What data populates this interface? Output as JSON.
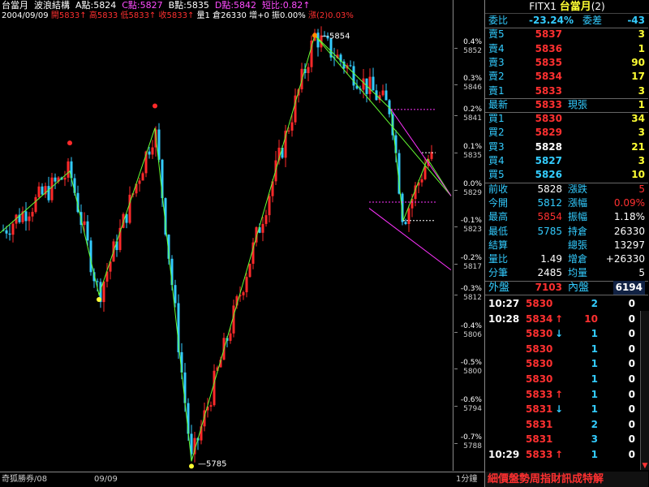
{
  "header": {
    "title": "台當月",
    "mode": "波浪結構",
    "a_point": "A點:5824",
    "c_point": "C點:5827",
    "b_point": "B點:5835",
    "d_point": "D點:5842",
    "short_ratio": "短比:0.82↑",
    "date": "2004/09/09",
    "open": "開5833↑",
    "high": "高5833",
    "low": "低5833↑",
    "close": "收5833↑",
    "volume": "量1",
    "open_interest": "倉26330",
    "increase": "增+0",
    "amplitude": "振0.00%",
    "rise": "漲(2)0.03%"
  },
  "footer": {
    "left": "奇狐勝券/08",
    "date": "09/09",
    "interval": "1分鐘"
  },
  "axis": {
    "ticks": [
      {
        "pct": "0.4%",
        "price": "5852",
        "value": 5852
      },
      {
        "pct": "0.3%",
        "price": "5846",
        "value": 5846
      },
      {
        "pct": "0.2%",
        "price": "5841",
        "value": 5841
      },
      {
        "pct": "0.1%",
        "price": "5835",
        "value": 5835
      },
      {
        "pct": "0.0%",
        "price": "5829",
        "value": 5829
      },
      {
        "pct": "-0.1%",
        "price": "5823",
        "value": 5823
      },
      {
        "pct": "-0.2%",
        "price": "5817",
        "value": 5817
      },
      {
        "pct": "-0.3%",
        "price": "5812",
        "value": 5812
      },
      {
        "pct": "-0.4%",
        "price": "5806",
        "value": 5806
      },
      {
        "pct": "-0.5%",
        "price": "5800",
        "value": 5800
      },
      {
        "pct": "-0.6%",
        "price": "5794",
        "value": 5794
      },
      {
        "pct": "-0.7%",
        "price": "5788",
        "value": 5788
      }
    ]
  },
  "chart_data": {
    "type": "candlestick",
    "ylim": [
      5784,
      5855
    ],
    "high_label": "5854",
    "low_label": "5785",
    "wave_points": [
      5822,
      5832,
      5812,
      5839,
      5785,
      5854,
      5842,
      5824,
      5834
    ],
    "colors": {
      "up": "#ff2a2a",
      "down": "#33ccff",
      "wave": "#66ff33",
      "envelope": "#ff33ff"
    }
  },
  "panel": {
    "symbol": "FITX1",
    "name": "台當月",
    "count": "(2)",
    "ratio_label": "委比",
    "ratio_value": "-23.24%",
    "diff_label": "委差",
    "diff_value": "-43",
    "asks": [
      {
        "label": "賣5",
        "price": "5837",
        "qty": "3"
      },
      {
        "label": "賣4",
        "price": "5836",
        "qty": "1"
      },
      {
        "label": "賣3",
        "price": "5835",
        "qty": "90"
      },
      {
        "label": "賣2",
        "price": "5834",
        "qty": "17"
      },
      {
        "label": "賣1",
        "price": "5833",
        "qty": "3"
      }
    ],
    "last": {
      "label": "最新",
      "price": "5833",
      "label2": "現張",
      "qty": "1"
    },
    "bids": [
      {
        "label": "買1",
        "price": "5830",
        "qty": "34"
      },
      {
        "label": "買2",
        "price": "5829",
        "qty": "3"
      },
      {
        "label": "買3",
        "price": "5828",
        "qty": "21"
      },
      {
        "label": "買4",
        "price": "5827",
        "qty": "3"
      },
      {
        "label": "買5",
        "price": "5826",
        "qty": "10"
      }
    ],
    "stats": [
      {
        "l1": "前收",
        "v1": "5828",
        "c1": "#ffffff",
        "l2": "漲跌",
        "v2": "5",
        "c2": "#ff3030"
      },
      {
        "l1": "今開",
        "v1": "5812",
        "c1": "#33ccff",
        "l2": "漲幅",
        "v2": "0.09%",
        "c2": "#ff3030"
      },
      {
        "l1": "最高",
        "v1": "5854",
        "c1": "#ff3030",
        "l2": "振幅",
        "v2": "1.18%",
        "c2": "#ffffff"
      },
      {
        "l1": "最低",
        "v1": "5785",
        "c1": "#33ccff",
        "l2": "持倉",
        "v2": "26330",
        "c2": "#ffffff"
      },
      {
        "l1": "結算",
        "v1": "",
        "c1": "#ffffff",
        "l2": "總張",
        "v2": "13297",
        "c2": "#ffffff"
      },
      {
        "l1": "量比",
        "v1": "1.49",
        "c1": "#ffffff",
        "l2": "增倉",
        "v2": "+26330",
        "c2": "#ffffff"
      },
      {
        "l1": "分筆",
        "v1": "2485",
        "c1": "#ffffff",
        "l2": "均量",
        "v2": "5",
        "c2": "#ffffff"
      }
    ],
    "outer": {
      "label": "外盤",
      "value": "7103",
      "label2": "內盤",
      "value2": "6194"
    },
    "ticks": [
      {
        "time": "10:27",
        "price": "5830",
        "arrow": "",
        "vol": "2",
        "chg": "0"
      },
      {
        "time": "10:28",
        "price": "5834",
        "arrow": "↑",
        "vol": "10",
        "chg": "0"
      },
      {
        "time": "",
        "price": "5830",
        "arrow": "↓",
        "vol": "1",
        "chg": "0"
      },
      {
        "time": "",
        "price": "5830",
        "arrow": "",
        "vol": "1",
        "chg": "0"
      },
      {
        "time": "",
        "price": "5830",
        "arrow": "",
        "vol": "1",
        "chg": "0"
      },
      {
        "time": "",
        "price": "5830",
        "arrow": "",
        "vol": "1",
        "chg": "0"
      },
      {
        "time": "",
        "price": "5833",
        "arrow": "↑",
        "vol": "1",
        "chg": "0"
      },
      {
        "time": "",
        "price": "5831",
        "arrow": "↓",
        "vol": "1",
        "chg": "0"
      },
      {
        "time": "",
        "price": "5831",
        "arrow": "",
        "vol": "2",
        "chg": "0"
      },
      {
        "time": "",
        "price": "5831",
        "arrow": "",
        "vol": "3",
        "chg": "0"
      },
      {
        "time": "10:29",
        "price": "5833",
        "arrow": "↑",
        "vol": "1",
        "chg": "0"
      }
    ],
    "footer_text": "細價盤勢周指財訊成特解"
  }
}
